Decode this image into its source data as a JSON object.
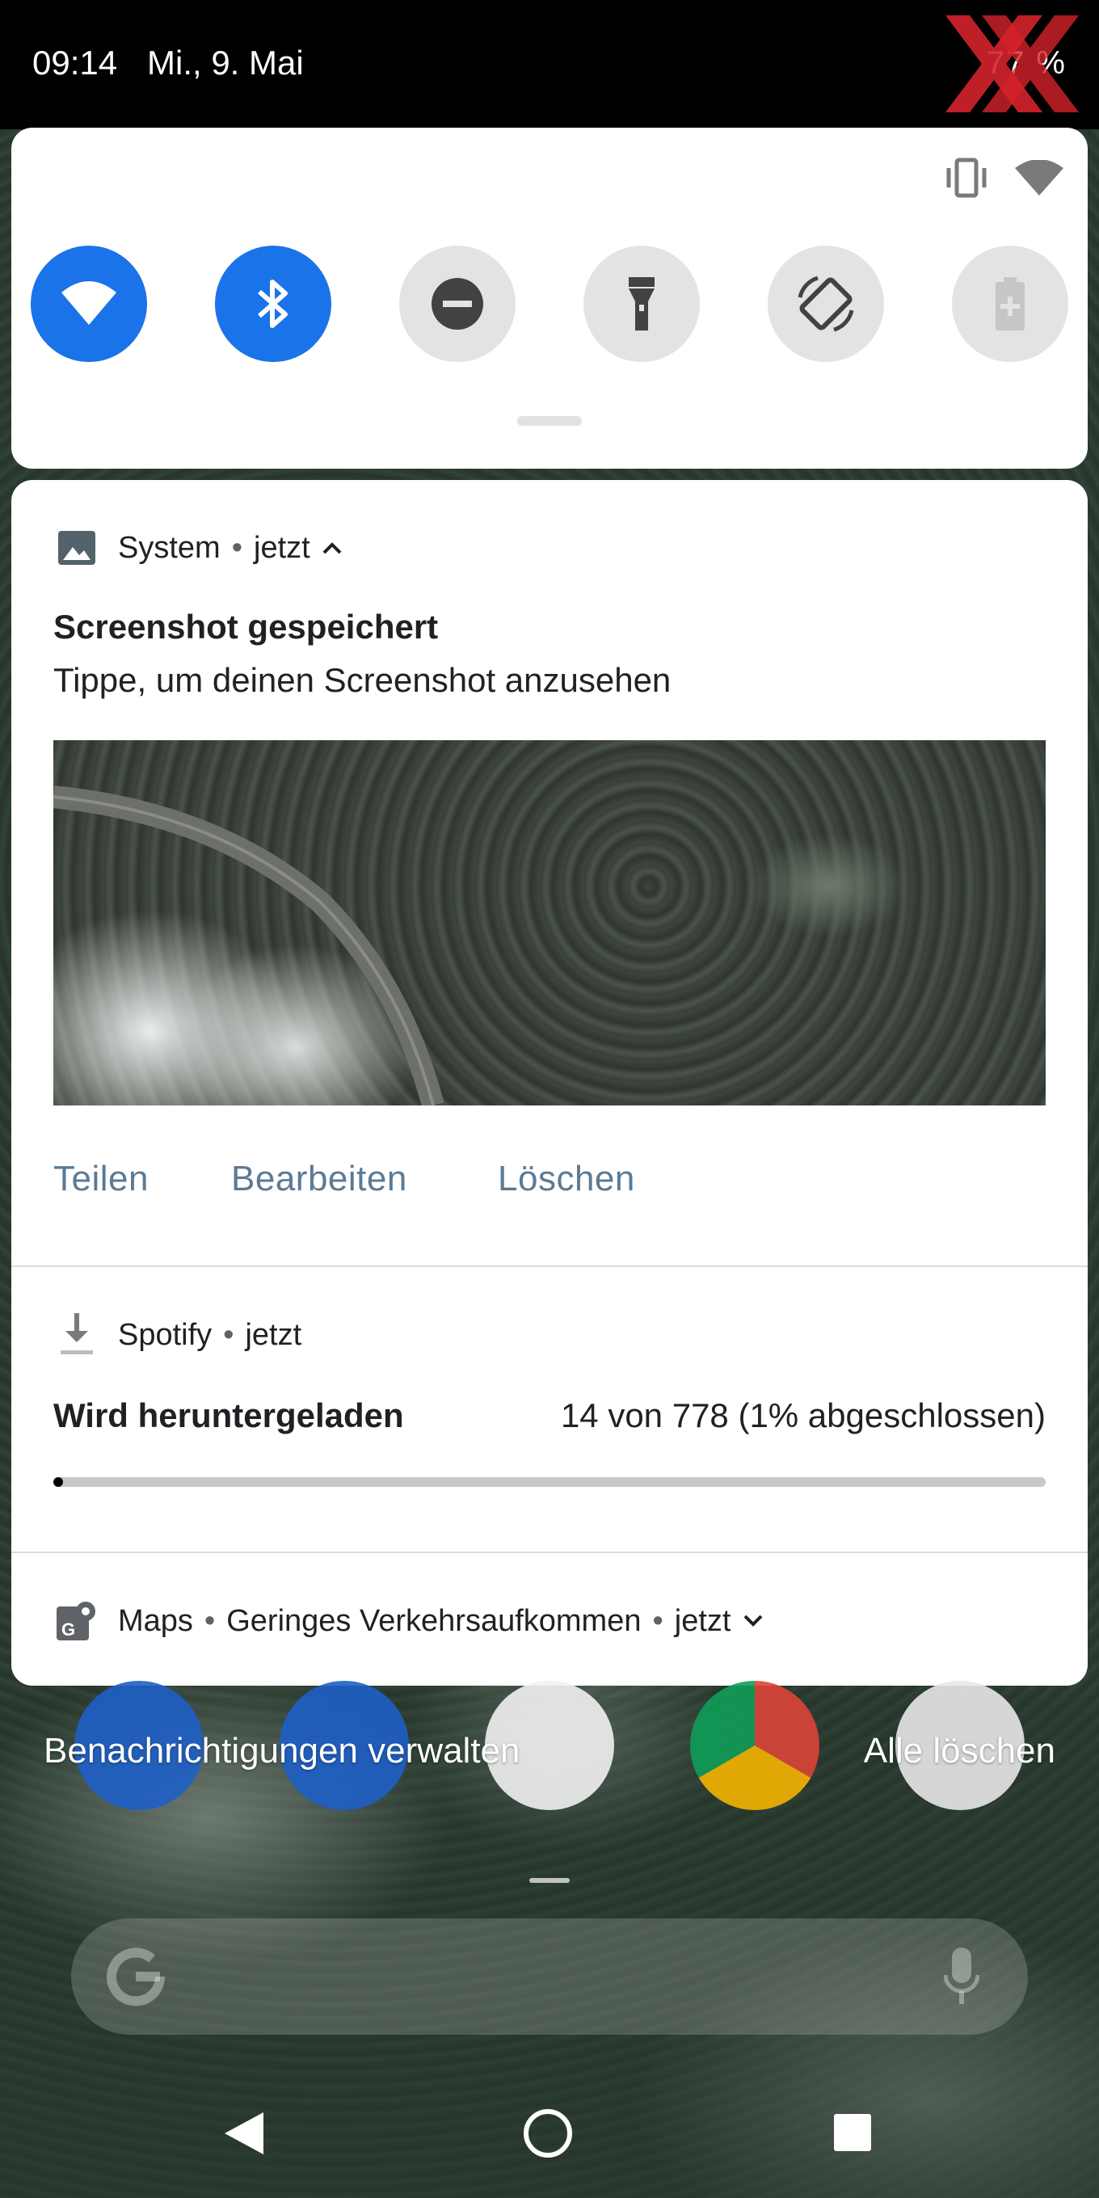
{
  "status_bar": {
    "time": "09:14",
    "date": "Mi., 9. Mai",
    "battery": "77 %"
  },
  "quick_settings": {
    "tiles": [
      {
        "icon": "wifi-icon",
        "state": "on"
      },
      {
        "icon": "bluetooth-icon",
        "state": "on"
      },
      {
        "icon": "do-not-disturb-icon",
        "state": "off"
      },
      {
        "icon": "flashlight-icon",
        "state": "off"
      },
      {
        "icon": "auto-rotate-icon",
        "state": "off"
      },
      {
        "icon": "battery-saver-icon",
        "state": "off"
      }
    ],
    "accent": "#1a73e8"
  },
  "notifications": {
    "screenshot": {
      "app": "System",
      "time": "jetzt",
      "title": "Screenshot gespeichert",
      "text": "Tippe, um deinen Screenshot anzusehen",
      "actions": {
        "share": "Teilen",
        "edit": "Bearbeiten",
        "delete": "Löschen"
      }
    },
    "spotify": {
      "app": "Spotify",
      "time": "jetzt",
      "title": "Wird heruntergeladen",
      "detail": "14 von 778 (1% abgeschlossen)",
      "progress": 0.01
    },
    "maps": {
      "app": "Maps",
      "subtext": "Geringes Verkehrsaufkommen",
      "time": "jetzt"
    }
  },
  "footer": {
    "manage": "Benachrichtigungen verwalten",
    "clear_all": "Alle löschen"
  },
  "separator": "•"
}
